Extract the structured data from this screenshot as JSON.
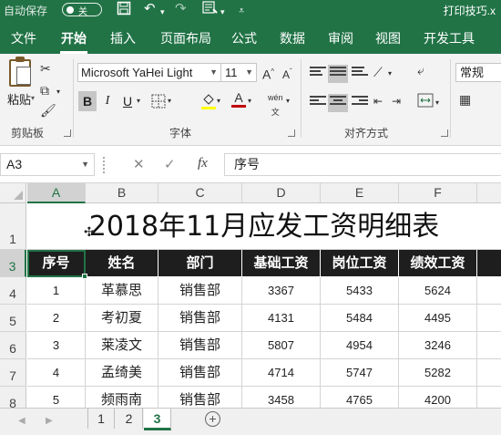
{
  "titlebar": {
    "autosave_label": "自动保存",
    "autosave_state": "关",
    "doc_title": "打印技巧.x"
  },
  "ribbon_tabs": [
    "文件",
    "开始",
    "插入",
    "页面布局",
    "公式",
    "数据",
    "审阅",
    "视图",
    "开发工具"
  ],
  "active_tab": "开始",
  "ribbon": {
    "paste_label": "粘贴",
    "font_name": "Microsoft YaHei Light",
    "font_size": "11",
    "number_format": "常规",
    "groups": {
      "clipboard": "剪贴板",
      "font": "字体",
      "alignment": "对齐方式"
    },
    "bold": "B",
    "italic": "I",
    "underline": "U",
    "font_color": "A",
    "phonetic": "wén"
  },
  "formula_bar": {
    "name_box": "A3",
    "fx": "fx",
    "value": "序号"
  },
  "columns": [
    "A",
    "B",
    "C",
    "D",
    "E",
    "F"
  ],
  "rows": [
    "1",
    "3",
    "4",
    "5",
    "6",
    "7",
    "8"
  ],
  "sheet_title": "2018年11月应发工资明细表",
  "table": {
    "headers": [
      "序号",
      "姓名",
      "部门",
      "基础工资",
      "岗位工资",
      "绩效工资"
    ],
    "rows": [
      [
        "1",
        "革慕思",
        "销售部",
        "3367",
        "5433",
        "5624"
      ],
      [
        "2",
        "考初夏",
        "销售部",
        "4131",
        "5484",
        "4495"
      ],
      [
        "3",
        "莱凌文",
        "销售部",
        "5807",
        "4954",
        "3246"
      ],
      [
        "4",
        "孟绮美",
        "销售部",
        "4714",
        "5747",
        "5282"
      ],
      [
        "5",
        "频雨南",
        "销售部",
        "3458",
        "4765",
        "4200"
      ]
    ]
  },
  "sheet_tabs": [
    "1",
    "2",
    "3"
  ],
  "active_sheet": "3",
  "colors": {
    "accent": "#217346",
    "header_fill": "#1e1e1e",
    "header_text": "#ffffff"
  }
}
